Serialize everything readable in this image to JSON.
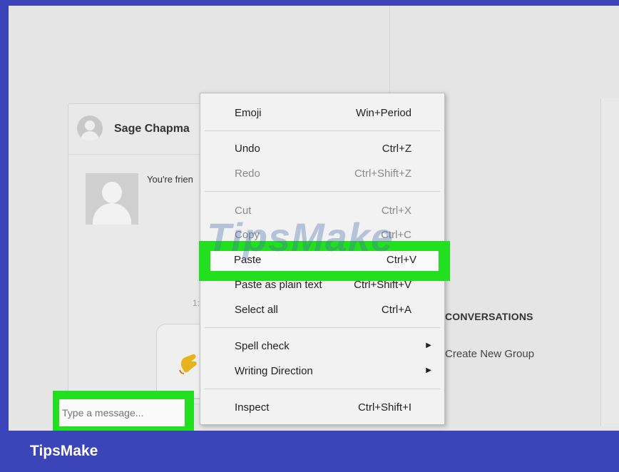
{
  "chat": {
    "contact_name": "Sage Chapma",
    "message_text": "You're frien",
    "time_text": "1:4",
    "input_placeholder": "Type a message..."
  },
  "side": {
    "conversations_heading": "CONVERSATIONS",
    "create_group": "Create New Group"
  },
  "context_menu": {
    "items": [
      {
        "label": "Emoji",
        "shortcut": "Win+Period"
      },
      {
        "label": "Undo",
        "shortcut": "Ctrl+Z"
      },
      {
        "label": "Redo",
        "shortcut": "Ctrl+Shift+Z"
      },
      {
        "label": "Cut",
        "shortcut": "Ctrl+X"
      },
      {
        "label": "Copy",
        "shortcut": "Ctrl+C"
      },
      {
        "label": "Paste",
        "shortcut": "Ctrl+V"
      },
      {
        "label": "Paste as plain text",
        "shortcut": "Ctrl+Shift+V"
      },
      {
        "label": "Select all",
        "shortcut": "Ctrl+A"
      },
      {
        "label": "Spell check",
        "shortcut": ""
      },
      {
        "label": "Writing Direction",
        "shortcut": ""
      },
      {
        "label": "Inspect",
        "shortcut": "Ctrl+Shift+I"
      }
    ],
    "submenu_arrow": "▶"
  },
  "watermark": "TipsMake",
  "brand": "TipsMake",
  "colors": {
    "highlight": "#22e01f",
    "brand_bar": "#3b44b8"
  }
}
